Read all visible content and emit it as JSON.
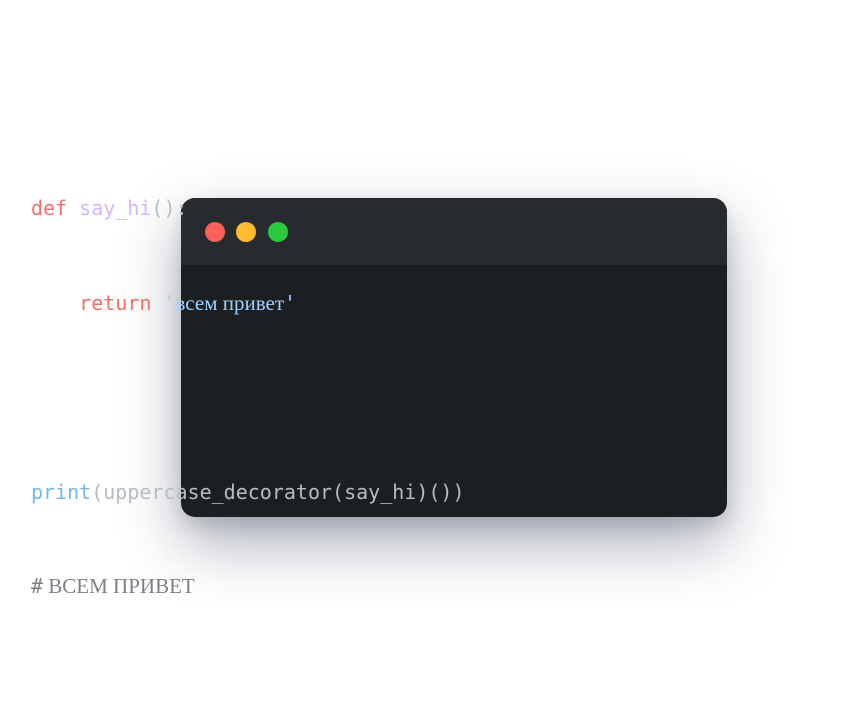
{
  "window": {
    "controls": [
      {
        "name": "close",
        "color": "#ff5f57"
      },
      {
        "name": "minimize",
        "color": "#febc2e"
      },
      {
        "name": "zoom",
        "color": "#28c840"
      }
    ]
  },
  "colors": {
    "keyword": "#f07167",
    "function_name": "#d8b4fe",
    "builtin": "#74b6f0",
    "string": "#9fd0ff",
    "punctuation": "#b6bcc3",
    "comment": "#7b8187",
    "background": "#1c1f21",
    "titlebar": "#272b2d"
  },
  "code": {
    "line1": {
      "keyword": "def",
      "space": " ",
      "name": "say_hi",
      "punct": "():"
    },
    "line2": {
      "indent": "    ",
      "keyword": "return",
      "space": " ",
      "quote_open": "'",
      "string": "всем привет",
      "quote_close": "'"
    },
    "line4": {
      "builtin": "print",
      "rest": "(uppercase_decorator(say_hi)())"
    },
    "line5": {
      "hash": "#",
      "comment": " ВСЕМ ПРИВЕТ"
    }
  }
}
